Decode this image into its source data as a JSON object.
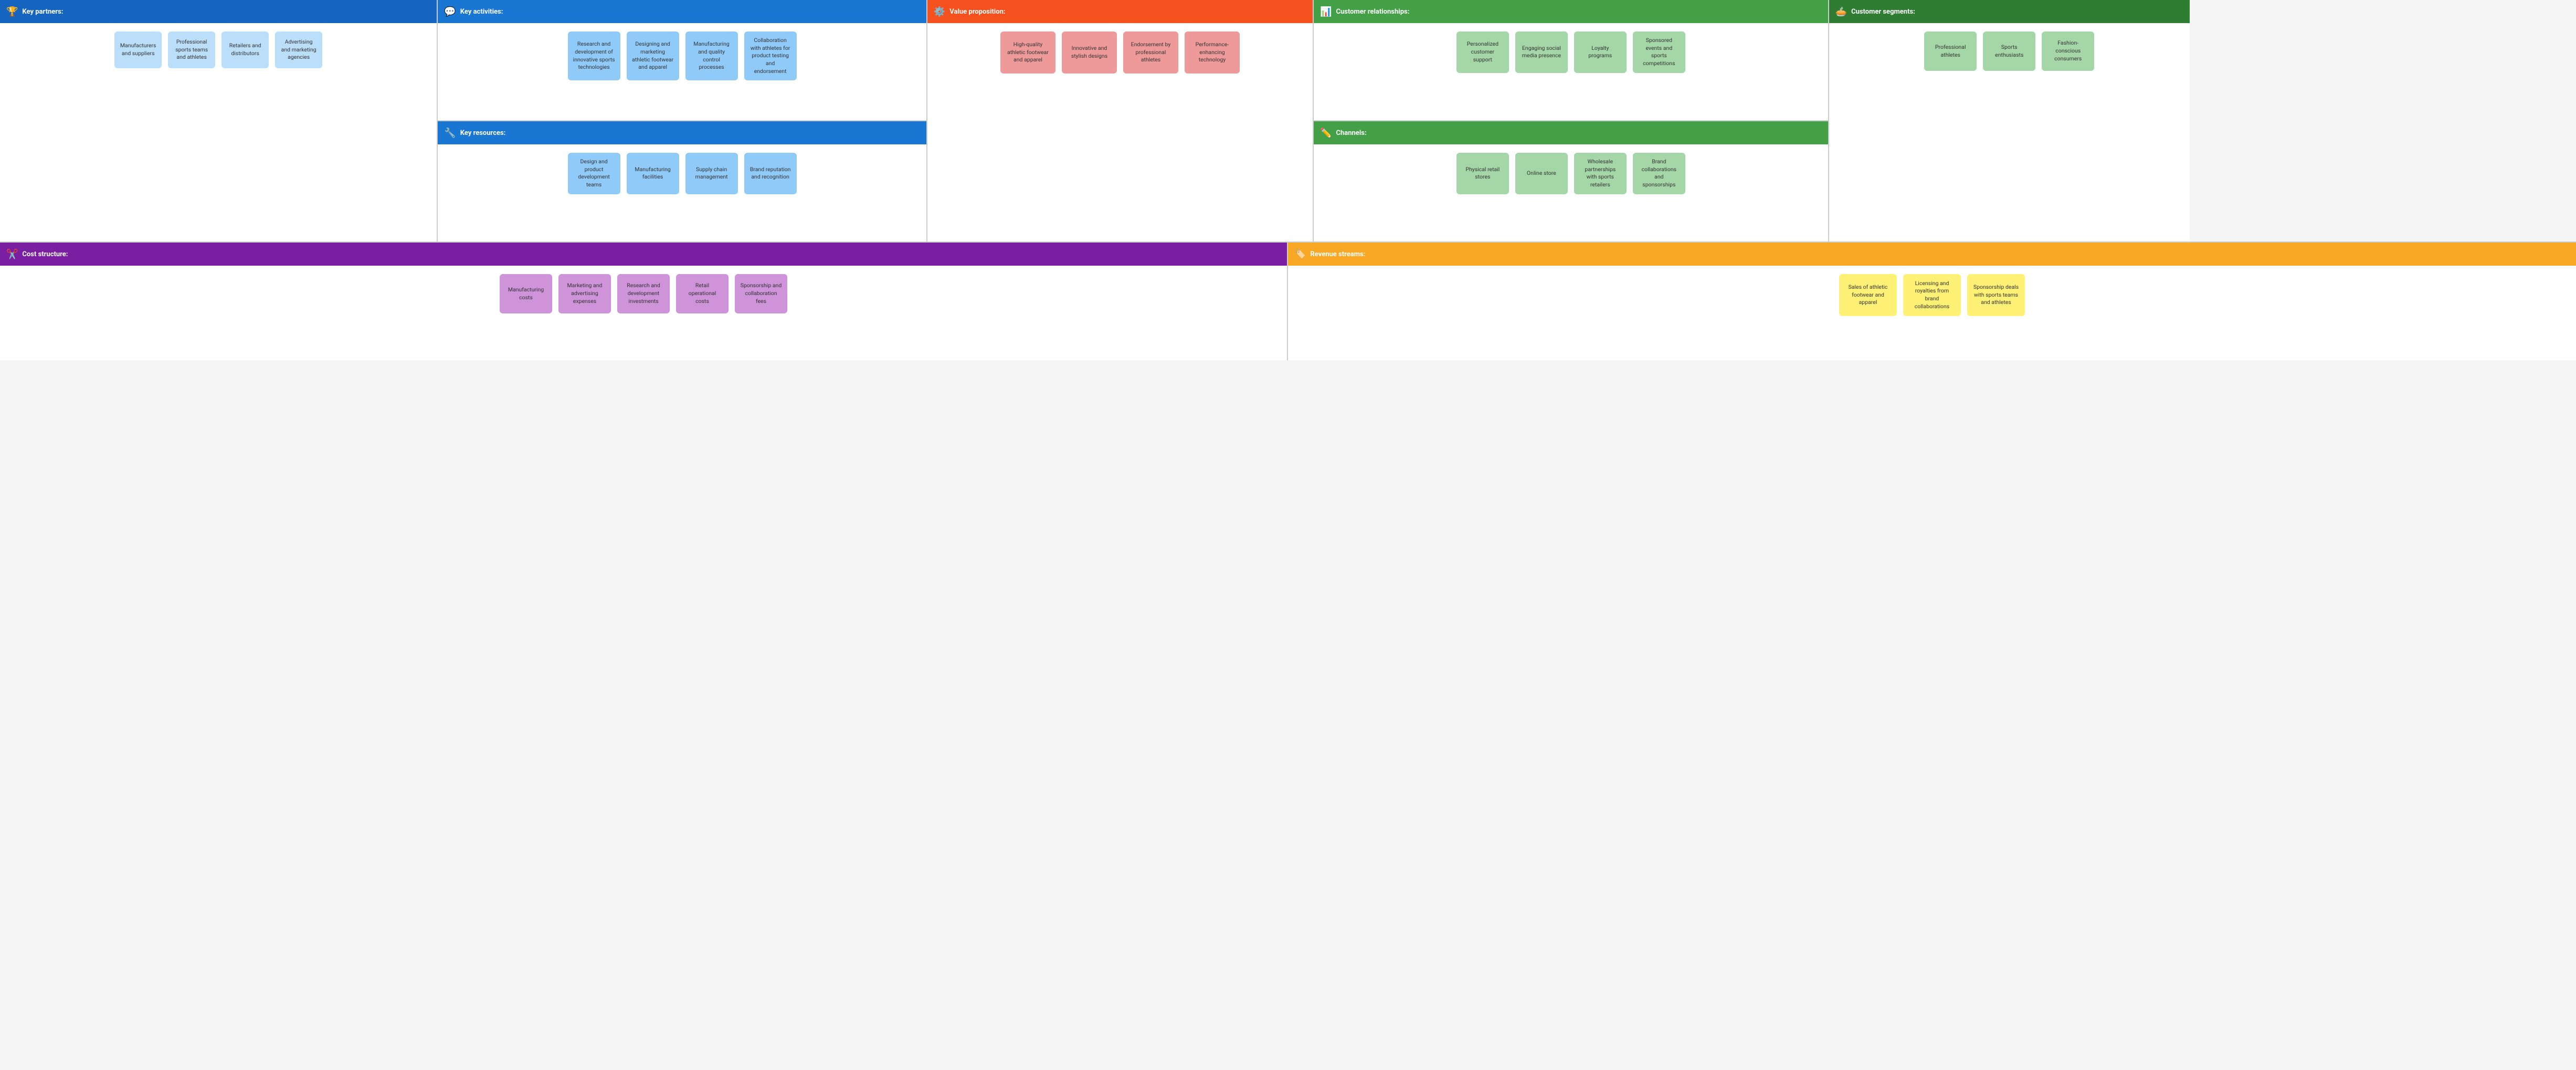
{
  "sections": {
    "keyPartners": {
      "title": "Key partners:",
      "icon": "🏆",
      "cards": [
        "Manufacturers and suppliers",
        "Professional sports teams and athletes",
        "Retailers and distributors",
        "Advertising and marketing agencies"
      ]
    },
    "keyActivities": {
      "title": "Key activities:",
      "icon": "💬",
      "cards": [
        "Research and development of innovative sports technologies",
        "Designing and marketing athletic footwear and apparel",
        "Manufacturing and quality control processes",
        "Collaboration with athletes for product testing and endorsement"
      ]
    },
    "keyResources": {
      "title": "Key resources:",
      "icon": "🔧",
      "cards": [
        "Design and product development teams",
        "Manufacturing facilities",
        "Supply chain management",
        "Brand reputation and recognition"
      ]
    },
    "valueProposition": {
      "title": "Value proposition:",
      "icon": "⚙️",
      "cards": [
        "High-quality athletic footwear and apparel",
        "Innovative and stylish designs",
        "Endorsement by professional athletes",
        "Performance-enhancing technology"
      ]
    },
    "customerRelationships": {
      "title": "Customer relationships:",
      "icon": "📊",
      "cards": [
        "Personalized customer support",
        "Engaging social media presence",
        "Loyalty programs",
        "Sponsored events and sports competitions"
      ]
    },
    "channels": {
      "title": "Channels:",
      "icon": "✏️",
      "cards": [
        "Physical retail stores",
        "Online store",
        "Wholesale partnerships with sports retailers",
        "Brand collaborations and sponsorships"
      ]
    },
    "customerSegments": {
      "title": "Customer segments:",
      "icon": "🥧",
      "cards": [
        "Professional athletes",
        "Sports enthusiasts",
        "Fashion-conscious consumers"
      ]
    },
    "costStructure": {
      "title": "Cost structure:",
      "icon": "✂️",
      "cards": [
        "Manufacturing costs",
        "Marketing and advertising expenses",
        "Research and development investments",
        "Retail operational costs",
        "Sponsorship and collaboration fees"
      ]
    },
    "revenueStreams": {
      "title": "Revenue streams:",
      "icon": "🏷️",
      "cards": [
        "Sales of athletic footwear and apparel",
        "Licensing and royalties from brand collaborations",
        "Sponsorship deals with sports teams and athletes"
      ]
    }
  }
}
